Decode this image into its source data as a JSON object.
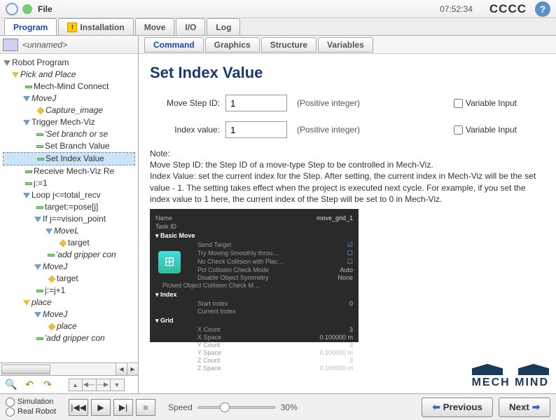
{
  "topbar": {
    "file_menu": "File",
    "time": "07:52:34",
    "cccc": "CCCC"
  },
  "maintabs": {
    "program": "Program",
    "installation": "Installation",
    "move": "Move",
    "io": "I/O",
    "log": "Log"
  },
  "program_name": "<unnamed>",
  "tree": {
    "root": "Robot Program",
    "pick_place": "Pick and Place",
    "mech_connect": "Mech-Mind Connect",
    "movej1": "MoveJ",
    "capture": "Capture_image",
    "trigger": "Trigger Mech-Viz",
    "set_branch_se": "'Set branch or se",
    "set_branch": "Set Branch Value",
    "set_index": "Set Index Value",
    "receive": "Receive Mech-Viz Re",
    "j1": "j:=1",
    "loop": "Loop j<=total_recv",
    "target_pose": "target:=pose[j]",
    "if_vision": "If j==vision_point",
    "movel1": "MoveL",
    "target1": "target",
    "add_grip1": "'add gripper con",
    "movej2": "MoveJ",
    "target2": "target",
    "jinc": "j:=j+1",
    "place": "place",
    "movej3": "MoveJ",
    "place2": "place",
    "add_grip2": "'add gripper con"
  },
  "subtabs": {
    "command": "Command",
    "graphics": "Graphics",
    "structure": "Structure",
    "variables": "Variables"
  },
  "cmd": {
    "title": "Set Index Value",
    "move_step_label": "Move Step ID:",
    "move_step_value": "1",
    "index_label": "Index value:",
    "index_value": "1",
    "pos_int": "(Positive integer)",
    "var_input": "Variable Input",
    "note_hdr": "Note:",
    "note_l1": "Move Step ID: the Step ID of a move-type Step to be controlled in Mech-Viz.",
    "note_l2": "Index Value: set the current index for the Step. After setting, the current index in Mech-Viz will be the set value - 1. The setting takes effect when the project is executed next cycle. For example, if you set the index value to 1 here, the current index of the Step will be set to 0 in Mech-Viz."
  },
  "mv_panel": {
    "name": "Name",
    "name_v": "move_grid_1",
    "task": "Task ID",
    "sec_basic": "Basic Move",
    "send_target": "Send Target",
    "try_moving": "Try Moving Smoothly throu…",
    "no_check": "No Check Collision with Plac…",
    "pcl_mode": "Pcl Collision Check Mode",
    "pcl_v": "Auto",
    "disable_sym": "Disable Object Symmetry",
    "disable_v": "None",
    "picked": "Picked Object Collision Check M…",
    "sec_index": "Index",
    "start_idx": "Start Index",
    "start_v": "0",
    "cur_idx": "Current Index",
    "sec_grid": "Grid",
    "xcount": "X Count",
    "xcount_v": "3",
    "xspace": "X Space",
    "xspace_v": "0.100000 m",
    "ycount": "Y Count",
    "ycount_v": "3",
    "yspace": "Y Space",
    "yspace_v": "0.100000 m",
    "zcount": "Z Count",
    "zcount_v": "3",
    "zspace": "Z Space",
    "zspace_v": "0.100000 m"
  },
  "logo": "MECH MIND",
  "bottom": {
    "simulation": "Simulation",
    "real_robot": "Real Robot",
    "speed_label": "Speed",
    "speed_val": "30%",
    "previous": "Previous",
    "next": "Next"
  }
}
